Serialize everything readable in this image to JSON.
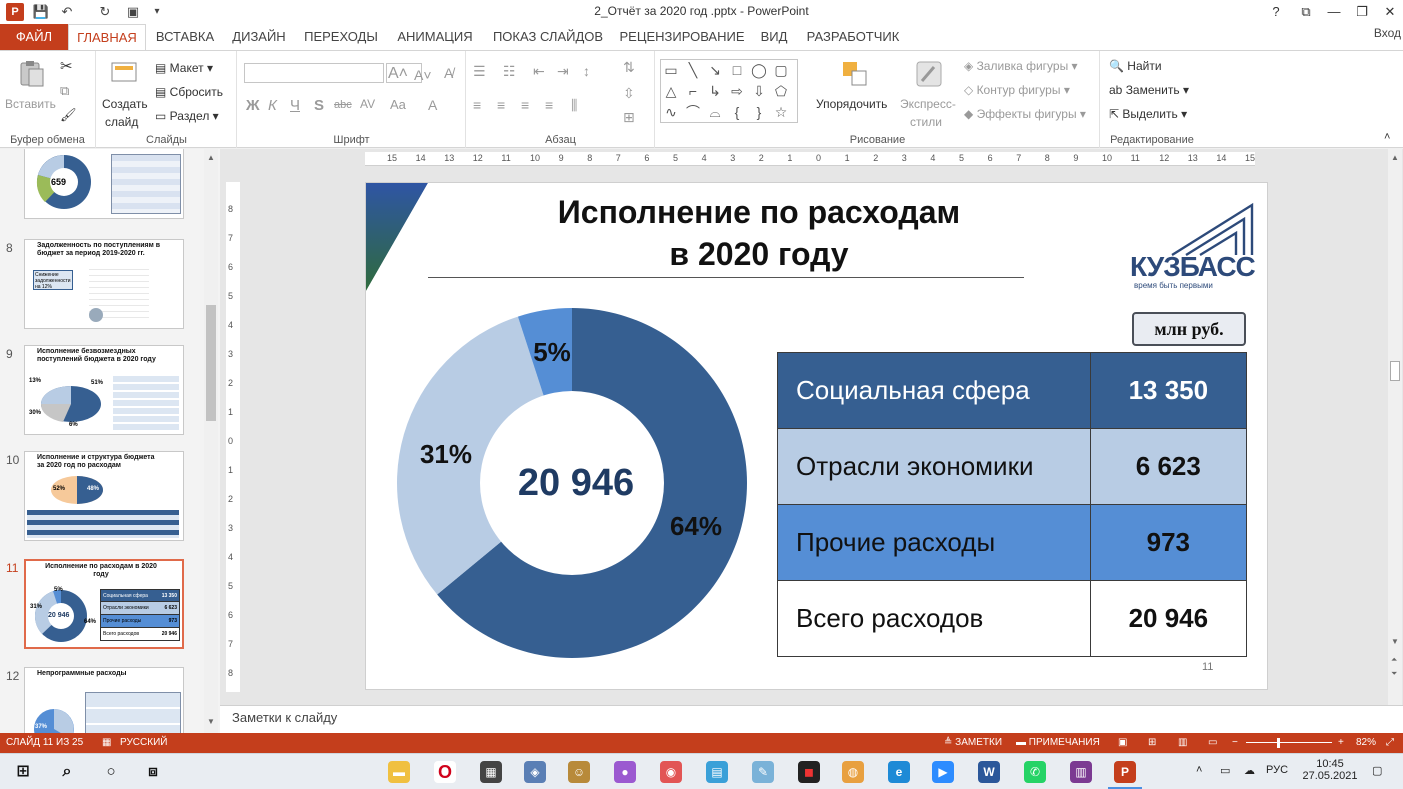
{
  "window": {
    "title": "2_Отчёт за 2020 год .pptx - PowerPoint",
    "help": "?",
    "controls": [
      "⧉",
      "—",
      "❐",
      "✕"
    ]
  },
  "tabs": [
    {
      "label": "ФАЙЛ"
    },
    {
      "label": "ГЛАВНАЯ"
    },
    {
      "label": "ВСТАВКА"
    },
    {
      "label": "ДИЗАЙН"
    },
    {
      "label": "ПЕРЕХОДЫ"
    },
    {
      "label": "АНИМАЦИЯ"
    },
    {
      "label": "ПОКАЗ СЛАЙДОВ"
    },
    {
      "label": "РЕЦЕНЗИРОВАНИЕ"
    },
    {
      "label": "ВИД"
    },
    {
      "label": "РАЗРАБОТЧИК"
    }
  ],
  "signin": "Вход",
  "ribbon": {
    "clipboard": {
      "paste": "Вставить",
      "label": "Буфер обмена"
    },
    "slides": {
      "create": "Создать",
      "create2": "слайд",
      "layout": "Макет",
      "reset": "Сбросить",
      "section": "Раздел",
      "label": "Слайды"
    },
    "font": {
      "label": "Шрифт",
      "bold": "Ж",
      "italic": "К",
      "underline": "Ч",
      "shadow": "S",
      "strike": "abc",
      "spacing": "AV",
      "case": "Aa",
      "grow": "A",
      "shrink": "A"
    },
    "paragraph": {
      "label": "Абзац"
    },
    "drawing": {
      "arrange": "Упорядочить",
      "styles": "Экспресс-",
      "styles2": "стили",
      "fill": "Заливка фигуры",
      "outline": "Контур фигуры",
      "effects": "Эффекты фигуры",
      "label": "Рисование"
    },
    "editing": {
      "find": "Найти",
      "replace": "Заменить",
      "select": "Выделить",
      "label": "Редактирование"
    }
  },
  "thumbnails": [
    {
      "num": "8",
      "title": "Задолженность по поступлениям в бюджет за период 2019-2020 гг."
    },
    {
      "num": "9",
      "title": "Исполнение безвозмездных поступлений бюджета в 2020 году"
    },
    {
      "num": "10",
      "title": "Исполнение и структура бюджета за 2020 год по расходам"
    },
    {
      "num": "11",
      "title": "Исполнение по расходам в 2020 году"
    },
    {
      "num": "12",
      "title": "Непрограммные расходы"
    }
  ],
  "thumb_details": {
    "t7_center": "659",
    "t8_badge": "Снижение задолженности на 12%",
    "t9_pct_a": "13%",
    "t9_pct_b": "51%",
    "t9_pct_c": "30%",
    "t9_pct_d": "6%",
    "t10_pct_a": "52%",
    "t10_pct_b": "48%",
    "t11_center": "20 946",
    "t11_pct": "31%",
    "t11_pct2": "64%",
    "t11_pct3": "5%",
    "t11_rows": [
      {
        "label": "Социальная сфера",
        "value": "13 350"
      },
      {
        "label": "Отрасли экономики",
        "value": "6 623"
      },
      {
        "label": "Прочие расходы",
        "value": "973"
      },
      {
        "label": "Всего расходов",
        "value": "20 946"
      }
    ],
    "t12_pct": "37%"
  },
  "ruler": {
    "h": [
      "15",
      "14",
      "13",
      "12",
      "11",
      "10",
      "9",
      "8",
      "7",
      "6",
      "5",
      "4",
      "3",
      "2",
      "1",
      "0",
      "1",
      "2",
      "3",
      "4",
      "5",
      "6",
      "7",
      "8",
      "9",
      "10",
      "11",
      "12",
      "13",
      "14",
      "15"
    ],
    "v": [
      "8",
      "7",
      "6",
      "5",
      "4",
      "3",
      "2",
      "1",
      "0",
      "1",
      "2",
      "3",
      "4",
      "5",
      "6",
      "7",
      "8"
    ]
  },
  "slide": {
    "title_line1": "Исполнение  по расходам",
    "title_line2": "в 2020 году",
    "logo_text": "КУЗБАСС",
    "logo_tagline": "время быть первыми",
    "unit": "млн руб.",
    "number": "11",
    "colors": {
      "dark": "#365f91",
      "light": "#b8cce4",
      "mid": "#558ed5",
      "white": "#ffffff"
    },
    "table": [
      {
        "label": "Социальная сфера",
        "value": "13 350",
        "bg": "#365f91",
        "fg": "#ffffff"
      },
      {
        "label": "Отрасли экономики",
        "value": "6 623",
        "bg": "#b8cce4",
        "fg": "#111111"
      },
      {
        "label": "Прочие расходы",
        "value": "973",
        "bg": "#558ed5",
        "fg": "#111111"
      },
      {
        "label": "Всего расходов",
        "value": "20 946",
        "bg": "#ffffff",
        "fg": "#111111"
      }
    ]
  },
  "chart_data": {
    "type": "pie",
    "center_label": "20 946",
    "slices": [
      {
        "label": "64%",
        "value": 64,
        "color": "#365f91"
      },
      {
        "label": "31%",
        "value": 31,
        "color": "#b8cce4"
      },
      {
        "label": "5%",
        "value": 5,
        "color": "#558ed5"
      }
    ]
  },
  "notes": {
    "placeholder": "Заметки к слайду"
  },
  "status": {
    "slide": "СЛАЙД 11 ИЗ 25",
    "lang": "РУССКИЙ",
    "notes": "ЗАМЕТКИ",
    "comments": "ПРИМЕЧАНИЯ",
    "zoom": "82%",
    "zoom_level": 82
  },
  "taskbar": {
    "lang": "РУС",
    "time": "10:45",
    "date": "27.05.2021"
  }
}
